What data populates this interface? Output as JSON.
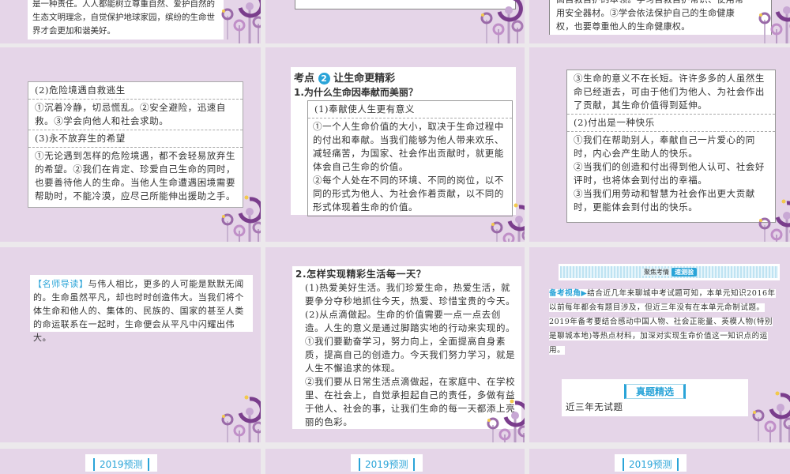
{
  "tile1": {
    "lines": [
      "是一种责任。人人都能树立尊重自然、爱护自然的",
      "生态文明理念，自觉保护地球家园，缤纷的生命世",
      "界才会更加和谐美好。"
    ]
  },
  "tile3": {
    "lines": [
      "高自救自护的本领。学习自救自护常识、使用常",
      "用安全器材。③学会依法保护自己的生命健康",
      "权，也要尊重他人的生命健康权。"
    ]
  },
  "tile4": {
    "h2": "(2)危险境遇自救逃生",
    "p2": "①沉着冷静，切忌慌乱。②安全避险，迅速自救。③学会向他人和社会求助。",
    "h3": "(3)永不放弃生的希望",
    "p3": "①无论遇到怎样的危险境遇，都不会轻易放弃生的希望。②我们在肯定、珍爱自己生命的同时，也要善待他人的生命。当他人生命遭遇困境需要帮助时，不能冷漠，应尽己所能伸出援助之手。"
  },
  "tile5": {
    "kaodian": "考点",
    "num": "2",
    "title": "让生命更精彩",
    "q1": "1.为什么生命因奉献而美丽？",
    "h1": "(1)奉献使人生更有意义",
    "p1": "①一个人生命价值的大小，取决于生命过程中的付出和奉献。当我们能够为他人带来欢乐、减轻痛苦，为国家、社会作出贡献时，就更能体会自己生命的价值。",
    "p2": "②每个人处在不同的环境、不同的岗位，以不同的形式为他人、为社会作着贡献，以不同的形式体现着生命的价值。"
  },
  "tile6": {
    "p0": "③生命的意义不在长短。许许多多的人虽然生命已经逝去，可由于他们为他人、为社会作出了贡献，其生命价值得到延伸。",
    "h2": "(2)付出是一种快乐",
    "p1": "①我们在帮助别人，奉献自己一片爱心的同时，内心会产生助人的快乐。",
    "p2": "②当我们的创造和付出得到他人认可、社会好评时，也将体会到付出的幸福。",
    "p3": "③当我们用劳动和智慧为社会作出更大贡献时，更能体会到付出的快乐。"
  },
  "tile7": {
    "tag": "【名师导读】",
    "text": "与伟人相比，更多的人可能是默默无闻的。生命虽然平凡，却也时时创造伟大。当我们将个体生命和他人的、集体的、民族的、国家的甚至人类的命运联系在一起时，生命便会从平凡中闪耀出伟大。"
  },
  "tile8": {
    "q2": "2.怎样实现精彩生活每一天？",
    "paras": [
      "(1)热爱美好生活。我们珍爱生命，热爱生活，就要争分夺秒地抓住今天，热爱、珍惜宝贵的今天。",
      "(2)从点滴做起。生命的价值需要一点一点去创造。人生的意义是通过脚踏实地的行动来实现的。",
      "①我们要勤奋学习，努力向上，全面提高自身素质，提高自己的创造力。今天我们努力学习，就是人生不懈追求的体现。",
      "②我们要从日常生活点滴做起，在家庭中、在学校里、在社会上，自觉承担起自己的责任，多做有益于他人、社会的事，让我们生命的每一天都添上亮丽的色彩。"
    ]
  },
  "tile9": {
    "banner_left": "聚焦考情",
    "banner_right": "速测验",
    "tag": "备考视角▶",
    "text": "结合近几年来聊城中考试题可知，本单元知识2016年以前每年都会有题目涉及，但近三年没有在本单元命制试题。2019年备考要结合感动中国人物、社会正能量、英模人物(特别是聊城本地)等热点材料，加深对实现生命价值这一知识点的运用。",
    "section": "真题精选",
    "note": "近三年无试题"
  },
  "row4": {
    "labels": [
      "2019预测",
      "2019预测",
      "2019预测"
    ]
  },
  "colors": {
    "tile": "#e5d5e8",
    "accent": "#2aa4d8",
    "deco": "#7a3d8c"
  }
}
